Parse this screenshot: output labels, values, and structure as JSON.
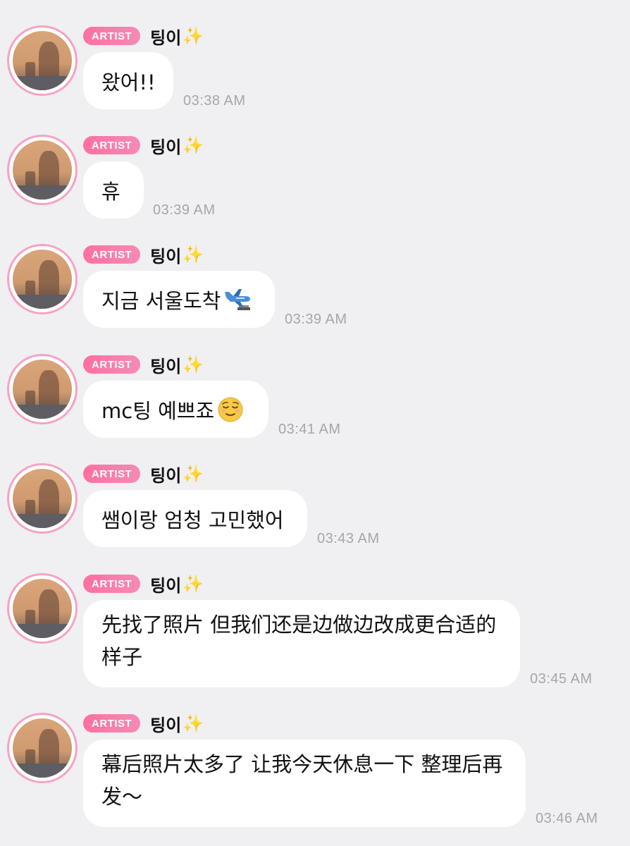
{
  "messages": [
    {
      "badge": "ARTIST",
      "sender": "팅이",
      "sparkle": "✨",
      "text": "왔어!!",
      "time": "03:38 AM"
    },
    {
      "badge": "ARTIST",
      "sender": "팅이",
      "sparkle": "✨",
      "text": "휴",
      "time": "03:39 AM"
    },
    {
      "badge": "ARTIST",
      "sender": "팅이",
      "sparkle": "✨",
      "text": "지금 서울도착",
      "emoji": "airplane-arriving-icon",
      "time": "03:39 AM"
    },
    {
      "badge": "ARTIST",
      "sender": "팅이",
      "sparkle": "✨",
      "text": "mc팅 예쁘죠",
      "emoji": "relieved-face-icon",
      "time": "03:41 AM"
    },
    {
      "badge": "ARTIST",
      "sender": "팅이",
      "sparkle": "✨",
      "text": "쌤이랑 엄청 고민했어",
      "time": "03:43 AM"
    },
    {
      "badge": "ARTIST",
      "sender": "팅이",
      "sparkle": "✨",
      "text": "先找了照片 但我们还是边做边改成更合适的样子",
      "time": "03:45 AM"
    },
    {
      "badge": "ARTIST",
      "sender": "팅이",
      "sparkle": "✨",
      "text": "幕后照片太多了 让我今天休息一下 整理后再发～",
      "time": "03:46 AM"
    }
  ],
  "colors": {
    "background": "#f0eff2",
    "bubble": "#ffffff",
    "badge_start": "#ff6fa3",
    "badge_end": "#f58ab5",
    "avatar_ring": "#f6a3c2",
    "timestamp": "#a6a5ab"
  }
}
